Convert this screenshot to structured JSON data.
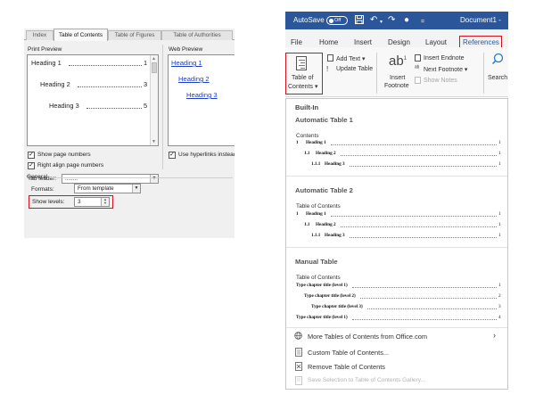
{
  "dialog": {
    "tabs": [
      {
        "label": "Index",
        "active": false
      },
      {
        "label": "Table of Contents",
        "active": true
      },
      {
        "label": "Table of Figures",
        "active": false
      },
      {
        "label": "Table of Authorities",
        "active": false
      }
    ],
    "print_preview": {
      "label": "Print Preview",
      "entries": [
        {
          "text": "Heading 1",
          "page": "1"
        },
        {
          "text": "Heading 2",
          "page": "3"
        },
        {
          "text": "Heading 3",
          "page": "5"
        }
      ]
    },
    "web_preview": {
      "label": "Web Preview",
      "entries": [
        {
          "text": "Heading 1"
        },
        {
          "text": "Heading 2"
        },
        {
          "text": "Heading 3"
        }
      ]
    },
    "show_page_numbers": {
      "label": "Show page numbers",
      "checked": true
    },
    "right_align": {
      "label": "Right align page numbers",
      "checked": true
    },
    "tab_leader": {
      "label": "Tab leader:",
      "value": "........"
    },
    "use_hyperlinks": {
      "label": "Use hyperlinks instead of page numbers",
      "checked": true
    },
    "general": {
      "label": "General",
      "formats_label": "Formats:",
      "formats_value": "From template",
      "show_levels_label": "Show levels:",
      "show_levels_value": "3"
    },
    "highlight_color": "#d0131d"
  },
  "word": {
    "titlebar": {
      "autosave_label": "AutoSave",
      "autosave_state": "Off",
      "document_name": "Document1 -",
      "icons": [
        "save-icon",
        "undo-icon",
        "redo-icon",
        "record-icon",
        "more-icon"
      ],
      "color": "#2b579a"
    },
    "menu": [
      "File",
      "Home",
      "Insert",
      "Design",
      "Layout",
      "References"
    ],
    "ribbon": {
      "toc_label_1": "Table of",
      "toc_label_2": "Contents ▾",
      "add_text": "Add Text ▾",
      "update_table": "Update Table",
      "insert_footnote_1": "Insert",
      "insert_footnote_2": "Footnote",
      "insert_endnote": "Insert Endnote",
      "next_footnote": "Next Footnote ▾",
      "show_notes": "Show Notes",
      "search": "Search"
    },
    "gallery": {
      "section": "Built-In",
      "auto1": {
        "heading": "Automatic Table 1",
        "caption": "Contents",
        "rows": [
          {
            "num": "1",
            "text": "Heading 1",
            "page": "1"
          },
          {
            "num": "1.1",
            "text": "Heading 2",
            "page": "1"
          },
          {
            "num": "1.1.1",
            "text": "Heading 3",
            "page": "1"
          }
        ]
      },
      "auto2": {
        "heading": "Automatic Table 2",
        "caption": "Table of Contents",
        "rows": [
          {
            "num": "1",
            "text": "Heading 1",
            "page": "1"
          },
          {
            "num": "1.1",
            "text": "Heading 2",
            "page": "1"
          },
          {
            "num": "1.1.1",
            "text": "Heading 3",
            "page": "1"
          }
        ]
      },
      "manual": {
        "heading": "Manual Table",
        "caption": "Table of Contents",
        "rows": [
          {
            "text": "Type chapter title (level 1)",
            "page": "1"
          },
          {
            "text": "Type chapter title (level 2)",
            "page": "2"
          },
          {
            "text": "Type chapter title (level 3)",
            "page": "3"
          },
          {
            "text": "Type chapter title (level 1)",
            "page": "4"
          }
        ]
      },
      "commands": [
        {
          "label": "More Tables of Contents from Office.com",
          "icon": "globe-icon",
          "enabled": true
        },
        {
          "label": "Custom Table of Contents...",
          "icon": "custom-toc-icon",
          "enabled": true
        },
        {
          "label": "Remove Table of Contents",
          "icon": "remove-toc-icon",
          "enabled": true
        },
        {
          "label": "Save Selection to Table of Contents Gallery...",
          "icon": "save-selection-icon",
          "enabled": false
        }
      ]
    }
  }
}
